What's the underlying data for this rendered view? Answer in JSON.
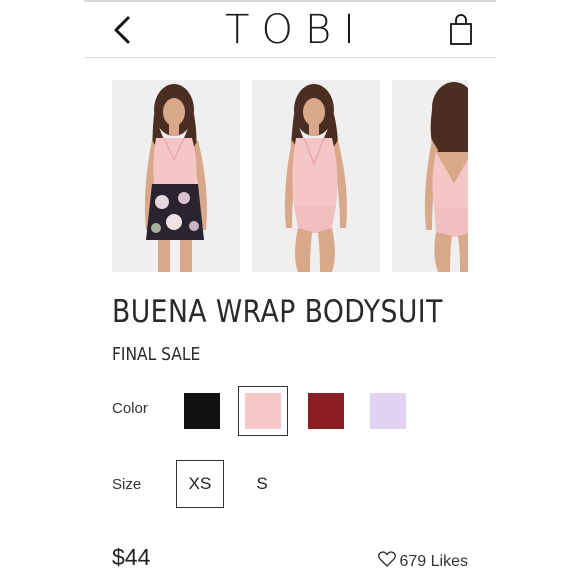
{
  "header": {
    "logo": "TOBI"
  },
  "product": {
    "title": "BUENA WRAP BODYSUIT",
    "badge": "FINAL SALE",
    "price": "$44",
    "likes": "679 Likes"
  },
  "gallery": {
    "images": [
      {
        "alt": "model-front-with-floral-skirt",
        "top_color": "#f4c6c6",
        "bottom_color": "#2a2430"
      },
      {
        "alt": "model-front-bodysuit",
        "top_color": "#f4c6c6",
        "bottom_color": "#f2bfc0"
      },
      {
        "alt": "model-back-bodysuit",
        "top_color": "#f4c6c6",
        "bottom_color": "#f2bfc0"
      }
    ]
  },
  "color": {
    "label": "Color",
    "selected": 1,
    "swatches": [
      {
        "name": "black",
        "hex": "#111111"
      },
      {
        "name": "blush",
        "hex": "#f6c8c8"
      },
      {
        "name": "burgundy",
        "hex": "#8c1d24"
      },
      {
        "name": "lavender",
        "hex": "#e3d3f3"
      }
    ]
  },
  "size": {
    "label": "Size",
    "selected": 0,
    "options": [
      "XS",
      "S"
    ]
  }
}
